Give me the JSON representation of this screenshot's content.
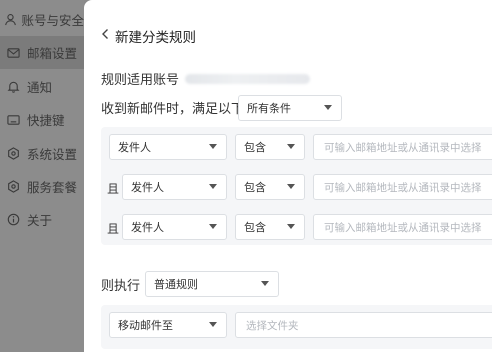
{
  "sidebar": {
    "items": [
      {
        "label": "账号与安全",
        "icon": "user-icon"
      },
      {
        "label": "邮箱设置",
        "icon": "mail-icon",
        "active": true
      },
      {
        "label": "通知",
        "icon": "bell-icon"
      },
      {
        "label": "快捷键",
        "icon": "keyboard-icon"
      },
      {
        "label": "系统设置",
        "icon": "hexagon-settings-icon"
      },
      {
        "label": "服务套餐",
        "icon": "hexagon-package-icon"
      },
      {
        "label": "关于",
        "icon": "info-icon"
      }
    ]
  },
  "header": {
    "back_title": "新建分类规则"
  },
  "rule": {
    "target_label": "规则适用账号"
  },
  "condition": {
    "prefix": "收到新邮件时，满足以下",
    "match_mode": "所有条件",
    "and_label": "且",
    "rows": [
      {
        "field": "发件人",
        "operator": "包含",
        "placeholder": "可输入邮箱地址或从通讯录中选择"
      },
      {
        "field": "发件人",
        "operator": "包含",
        "placeholder": "可输入邮箱地址或从通讯录中选择"
      },
      {
        "field": "发件人",
        "operator": "包含",
        "placeholder": "可输入邮箱地址或从通讯录中选择"
      }
    ]
  },
  "action": {
    "label": "则执行",
    "rule_type": "普通规则",
    "action_type": "移动邮件至",
    "folder_placeholder": "选择文件夹"
  }
}
